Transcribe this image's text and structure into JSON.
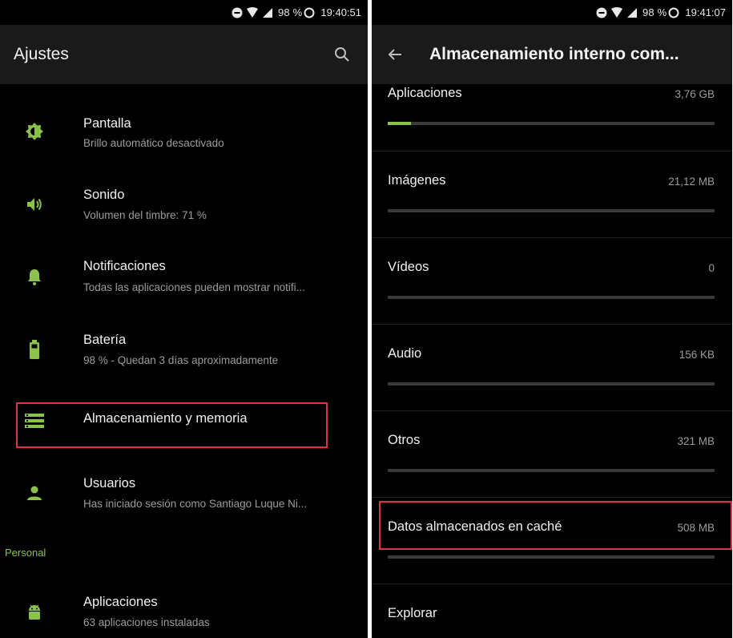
{
  "left": {
    "status": {
      "battery": "98 %",
      "time": "19:40:51"
    },
    "title": "Ajustes",
    "section_label": "Personal",
    "items": [
      {
        "title": "Pantalla",
        "subtitle": "Brillo automático desactivado",
        "icon": "brightness-icon"
      },
      {
        "title": "Sonido",
        "subtitle": "Volumen del timbre: 71 %",
        "icon": "volume-icon"
      },
      {
        "title": "Notificaciones",
        "subtitle": "Todas las aplicaciones pueden mostrar notifi...",
        "icon": "bell-icon"
      },
      {
        "title": "Batería",
        "subtitle": "98 % - Quedan 3 días aproximadamente",
        "icon": "battery-icon"
      },
      {
        "title": "Almacenamiento y memoria",
        "subtitle": "",
        "icon": "storage-icon",
        "highlighted": true
      },
      {
        "title": "Usuarios",
        "subtitle": "Has iniciado sesión como Santiago Luque Ni...",
        "icon": "person-icon"
      },
      {
        "title": "Aplicaciones",
        "subtitle": "63 aplicaciones instaladas",
        "icon": "android-icon"
      }
    ]
  },
  "right": {
    "status": {
      "battery": "98 %",
      "time": "19:41:07"
    },
    "title": "Almacenamiento interno com...",
    "rows": [
      {
        "label": "Aplicaciones",
        "value": "3,76 GB",
        "fill_percent": 7
      },
      {
        "label": "Imágenes",
        "value": "21,12 MB",
        "fill_percent": 0
      },
      {
        "label": "Vídeos",
        "value": "0",
        "fill_percent": 0
      },
      {
        "label": "Audio",
        "value": "156 KB",
        "fill_percent": 0
      },
      {
        "label": "Otros",
        "value": "321 MB",
        "fill_percent": 0
      },
      {
        "label": "Datos almacenados en caché",
        "value": "508 MB",
        "fill_percent": 0,
        "highlighted": true
      }
    ],
    "explore_label": "Explorar"
  },
  "colors": {
    "accent": "#8bc34a",
    "highlight": "#e0304a",
    "background": "#000000",
    "app_bar": "#1a1a1a",
    "secondary_text": "#9c9c9c"
  }
}
